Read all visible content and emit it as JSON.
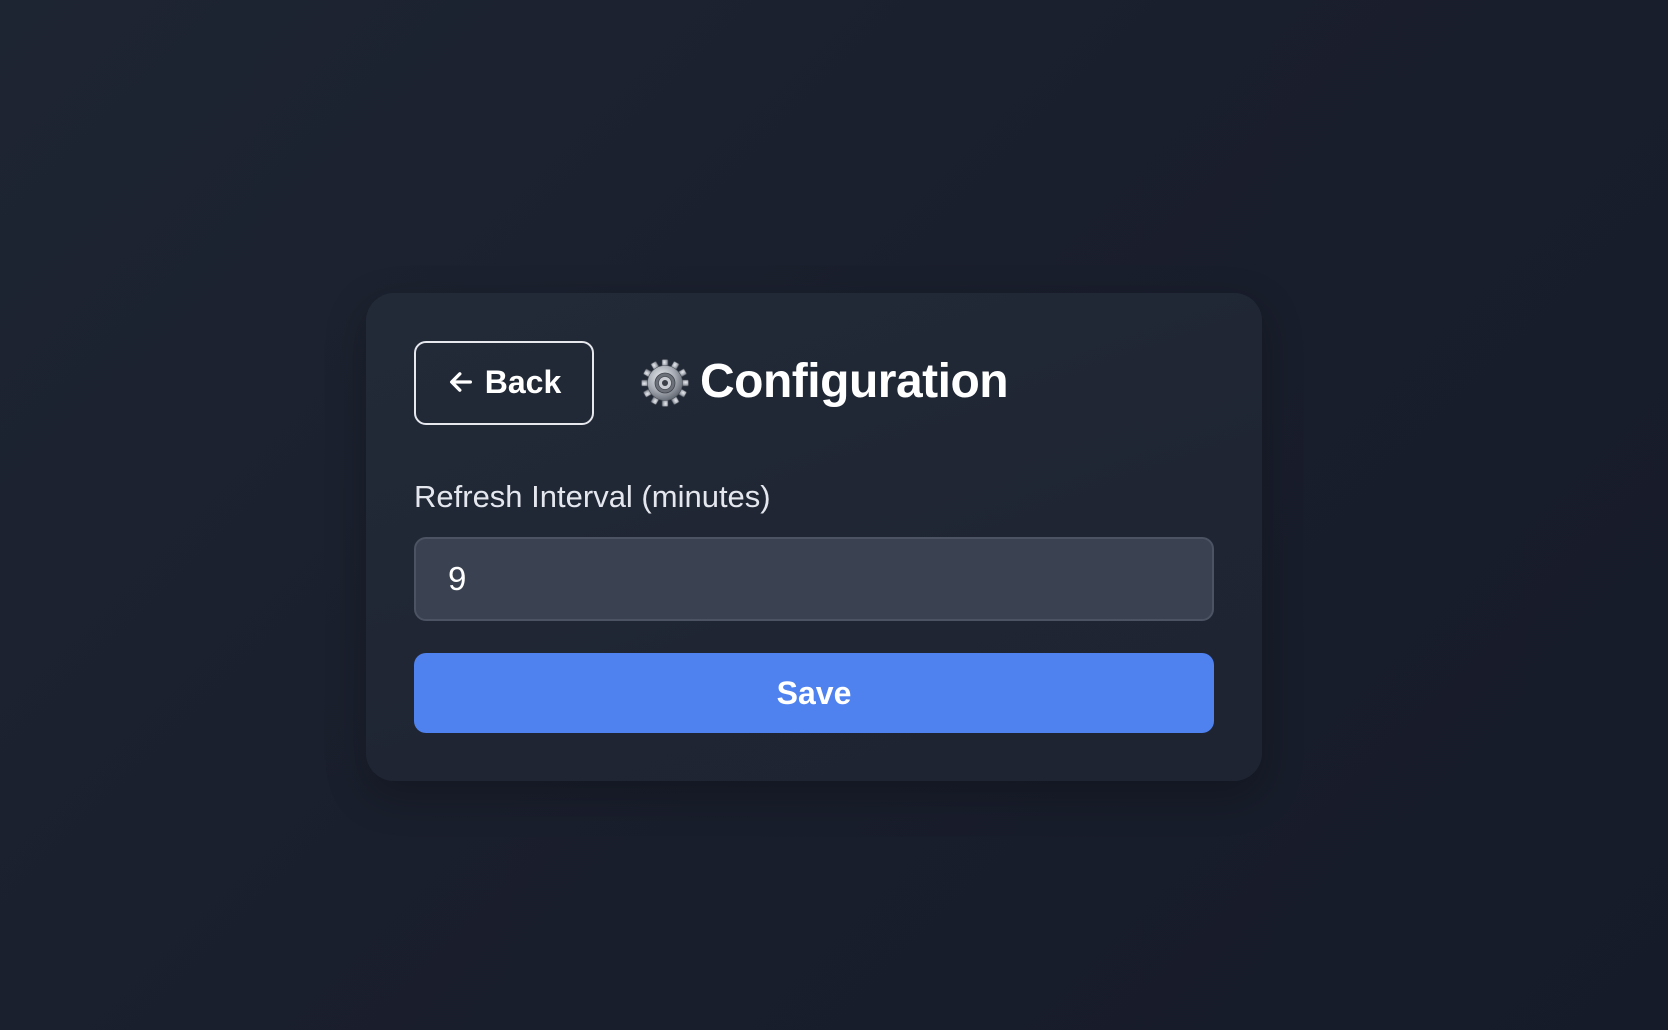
{
  "header": {
    "back_label": "Back",
    "back_icon": "arrow-left-icon",
    "title": "Configuration",
    "title_icon": "gear-icon"
  },
  "form": {
    "refresh_label": "Refresh Interval (minutes)",
    "refresh_value": "9"
  },
  "actions": {
    "save_label": "Save"
  },
  "colors": {
    "background": "#1a1f2d",
    "card": "#202634",
    "input_bg": "#3a4150",
    "primary": "#4f81ef",
    "text": "#ffffff"
  }
}
